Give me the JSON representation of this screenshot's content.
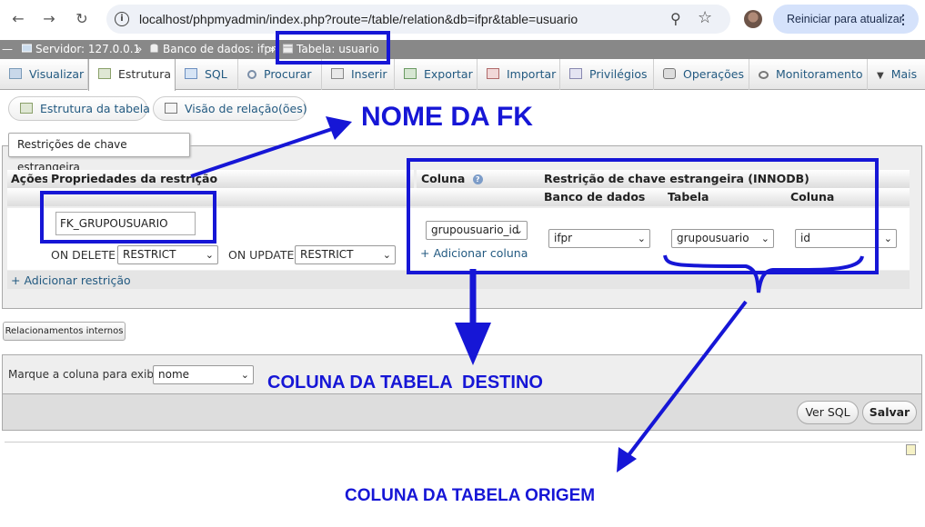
{
  "browser": {
    "url": "localhost/phpmyadmin/index.php?route=/table/relation&db=ifpr&table=usuario",
    "update_label": "Reiniciar para atualizar",
    "icons": [
      "back-icon",
      "forward-icon",
      "reload-icon",
      "info-icon",
      "zoom-icon",
      "star-icon",
      "kebab-icon"
    ]
  },
  "breadcrumb": {
    "server": "Servidor: 127.0.0.1",
    "database": "Banco de dados: ifpr",
    "table": "Tabela: usuario",
    "separator": "»"
  },
  "tabs": [
    {
      "label": "Visualizar",
      "icon": "browse-icon",
      "active": false
    },
    {
      "label": "Estrutura",
      "icon": "structure-icon",
      "active": true
    },
    {
      "label": "SQL",
      "icon": "sql-icon",
      "active": false
    },
    {
      "label": "Procurar",
      "icon": "search-icon",
      "active": false
    },
    {
      "label": "Inserir",
      "icon": "insert-icon",
      "active": false
    },
    {
      "label": "Exportar",
      "icon": "export-icon",
      "active": false
    },
    {
      "label": "Importar",
      "icon": "import-icon",
      "active": false
    },
    {
      "label": "Privilégios",
      "icon": "privileges-icon",
      "active": false
    },
    {
      "label": "Operações",
      "icon": "operations-icon",
      "active": false
    },
    {
      "label": "Monitoramento",
      "icon": "tracking-icon",
      "active": false
    },
    {
      "label": "Mais",
      "icon": "chevron-down-icon",
      "active": false
    }
  ],
  "subnav": {
    "structure": "Estrutura da tabela",
    "relation_view": "Visão de relação(ões)"
  },
  "fk_section": {
    "legend": "Restrições de chave estrangeira",
    "headers": {
      "actions": "Ações",
      "properties": "Propriedades da restrição",
      "column": "Coluna",
      "fk_restriction": "Restrição de chave estrangeira (INNODB)",
      "database": "Banco de dados",
      "table": "Tabela",
      "target_column": "Coluna"
    },
    "row": {
      "constraint_name": "FK_GRUPOUSUARIO",
      "on_delete_label": "ON DELETE",
      "on_delete_value": "RESTRICT",
      "on_update_label": "ON UPDATE",
      "on_update_value": "RESTRICT",
      "column_value": "grupousuario_id",
      "add_column": "+ Adicionar coluna",
      "database_value": "ifpr",
      "table_value": "grupousuario",
      "target_column_value": "id"
    },
    "add_constraint": "+ Adicionar restrição"
  },
  "internal_relations_button": "Relacionamentos internos",
  "display_column": {
    "label": "Marque a coluna para exibir:",
    "value": "nome"
  },
  "actions": {
    "preview_sql": "Ver SQL",
    "save": "Salvar"
  },
  "annotations": {
    "fk_name": "NOME DA FK",
    "target_column": "COLUNA DA TABELA  DESTINO",
    "source_column": "COLUNA DA TABELA ORIGEM",
    "color": "#1616d6"
  }
}
